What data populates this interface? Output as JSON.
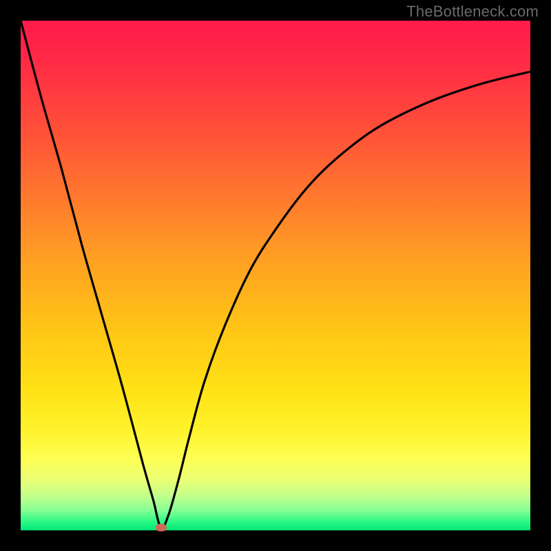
{
  "watermark": "TheBottleneck.com",
  "chart_data": {
    "type": "line",
    "title": "",
    "xlabel": "",
    "ylabel": "",
    "xlim": [
      0,
      100
    ],
    "ylim": [
      0,
      100
    ],
    "grid": false,
    "series": [
      {
        "name": "curve",
        "x": [
          0,
          4,
          8,
          12,
          16,
          20,
          24,
          26,
          27.5,
          29,
          31,
          33,
          36,
          40,
          45,
          50,
          56,
          62,
          70,
          80,
          90,
          100
        ],
        "y": [
          100,
          85,
          71,
          56,
          42,
          28,
          13,
          6,
          0.5,
          3,
          10,
          18,
          29,
          40,
          51,
          59,
          67,
          73,
          79,
          84,
          87.5,
          90
        ]
      }
    ],
    "marker": {
      "x": 27.5,
      "y": 0.5
    },
    "colors": {
      "curve": "#000000",
      "marker": "#cf6a57",
      "gradient_top": "#ff1a4a",
      "gradient_bottom": "#00e676"
    }
  }
}
